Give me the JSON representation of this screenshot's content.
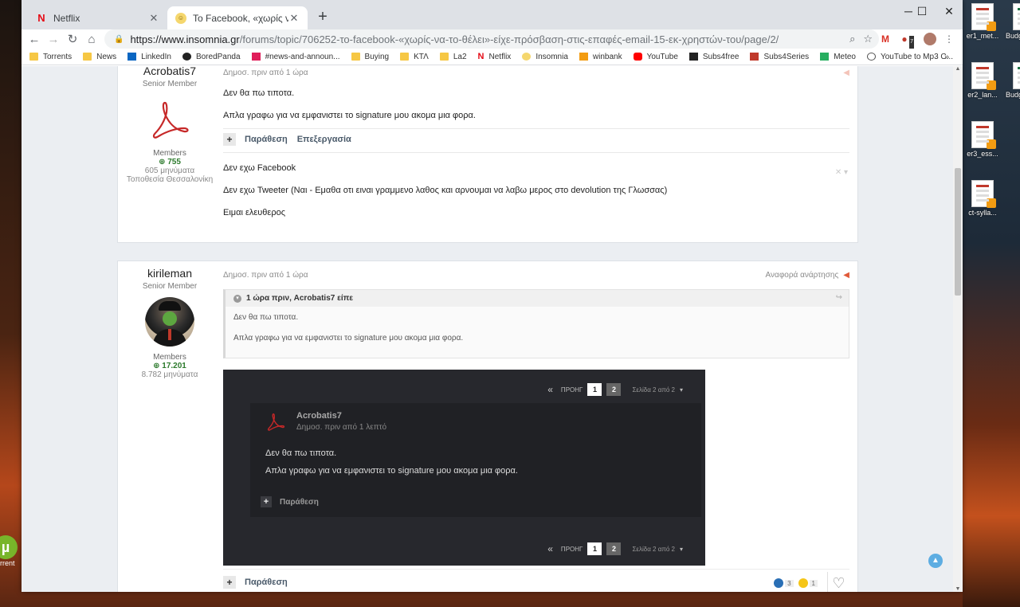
{
  "browser": {
    "tabs": [
      {
        "title": "Netflix",
        "favicon": "N"
      },
      {
        "title": "Το Facebook, «χωρίς να το θέλει»-είχε πρόσβαση",
        "favicon": "☺"
      }
    ],
    "url_host": "https://www.insomnia.gr",
    "url_path": "/forums/topic/706252-το-facebook-«χωρίς-να-το-θέλει»-είχε-πρόσβαση-στις-επαφές-email-15-εκ-χρηστών-του/page/2/",
    "extension_badge": "7"
  },
  "bookmarks": [
    {
      "label": "Torrents",
      "icon": "folder"
    },
    {
      "label": "News",
      "icon": "folder"
    },
    {
      "label": "LinkedIn",
      "icon": "linkedin"
    },
    {
      "label": "BoredPanda",
      "icon": "bp"
    },
    {
      "label": "#news-and-announ...",
      "icon": "slack"
    },
    {
      "label": "Buying",
      "icon": "folder"
    },
    {
      "label": "ΚΤΛ",
      "icon": "folder"
    },
    {
      "label": "La2",
      "icon": "folder"
    },
    {
      "label": "Netflix",
      "icon": "nf"
    },
    {
      "label": "Insomnia",
      "icon": "ins"
    },
    {
      "label": "winbank",
      "icon": "wb"
    },
    {
      "label": "YouTube",
      "icon": "yt"
    },
    {
      "label": "Subs4free",
      "icon": "sub"
    },
    {
      "label": "Subs4Series",
      "icon": "s4"
    },
    {
      "label": "Meteo",
      "icon": "met"
    },
    {
      "label": "YouTube to Mp3 C...",
      "icon": "ytm"
    }
  ],
  "desktop": {
    "right_icons": [
      "er1_met...",
      "er2_lan...",
      "er3_ess...",
      "ct-sylla..."
    ],
    "far_right": [
      "Budg Simpl",
      "Budg Simpl"
    ],
    "left_label": "rrent"
  },
  "post1": {
    "username": "Acrobatis7",
    "rank": "Senior Member",
    "group": "Members",
    "reputation": "755",
    "posts": "605 μηνύματα",
    "location": "Τοποθεσία Θεσσαλονίκη",
    "date": "Δημοσ. πριν από 1 ώρα",
    "lines": [
      "Δεν θα πω τιποτα.",
      "Απλα γραφω για να εμφανιστει το signature μου ακομα μια φορα."
    ],
    "actions": [
      "Παράθεση",
      "Επεξεργασία"
    ],
    "signature": [
      "Δεν εχω Facebook",
      "Δεν εχω Tweeter (Ναι - Εμαθα οτι ειναι γραμμενο λαθος και αρνουμαι να λαβω μερος στο devolution της Γλωσσας)",
      "Ειμαι ελευθερος"
    ]
  },
  "post2": {
    "username": "kirileman",
    "rank": "Senior Member",
    "group": "Members",
    "reputation": "17.201",
    "posts": "8.782 μηνύματα",
    "date": "Δημοσ. πριν από 1 ώρα",
    "report": "Αναφορά ανάρτησης",
    "quote_head": "1 ώρα πριν, Acrobatis7 είπε",
    "quote_lines": [
      "Δεν θα πω τιποτα.",
      "Απλα γραφω για να εμφανιστει το signature μου ακομα μια φορα."
    ],
    "screenshot": {
      "prev": "ΠΡΟΗΓ",
      "pages": [
        "1",
        "2"
      ],
      "page_of": "Σελίδα 2 από 2",
      "author": "Acrobatis7",
      "author_date": "Δημοσ. πριν από 1 λεπτό",
      "lines": [
        "Δεν θα πω τιποτα.",
        "Απλα γραφω για να εμφανιστει το signature μου ακομα μια φορα."
      ],
      "quote_label": "Παράθεση"
    },
    "bottom_action": "Παράθεση",
    "reactions": [
      {
        "icon": "like-icon",
        "count": "3",
        "color": "#2a6fb5"
      },
      {
        "icon": "haha-icon",
        "count": "1",
        "color": "#f5c518"
      }
    ]
  }
}
